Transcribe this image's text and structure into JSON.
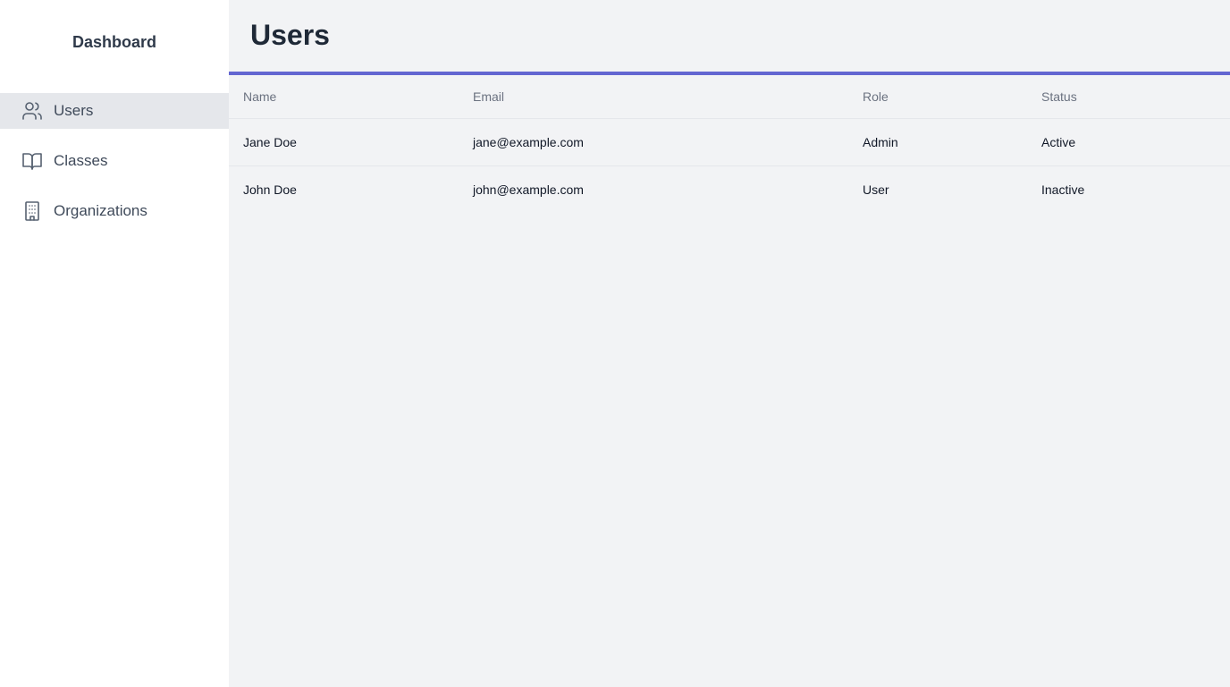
{
  "sidebar": {
    "brand": "Dashboard",
    "items": [
      {
        "label": "Users",
        "icon": "users-icon",
        "active": true
      },
      {
        "label": "Classes",
        "icon": "book-open-icon",
        "active": false
      },
      {
        "label": "Organizations",
        "icon": "building-icon",
        "active": false
      }
    ]
  },
  "main": {
    "title": "Users",
    "accent_color": "#6366d1",
    "table": {
      "columns": [
        "Name",
        "Email",
        "Role",
        "Status"
      ],
      "rows": [
        [
          "Jane Doe",
          "jane@example.com",
          "Admin",
          "Active"
        ],
        [
          "John Doe",
          "john@example.com",
          "User",
          "Inactive"
        ]
      ]
    }
  }
}
